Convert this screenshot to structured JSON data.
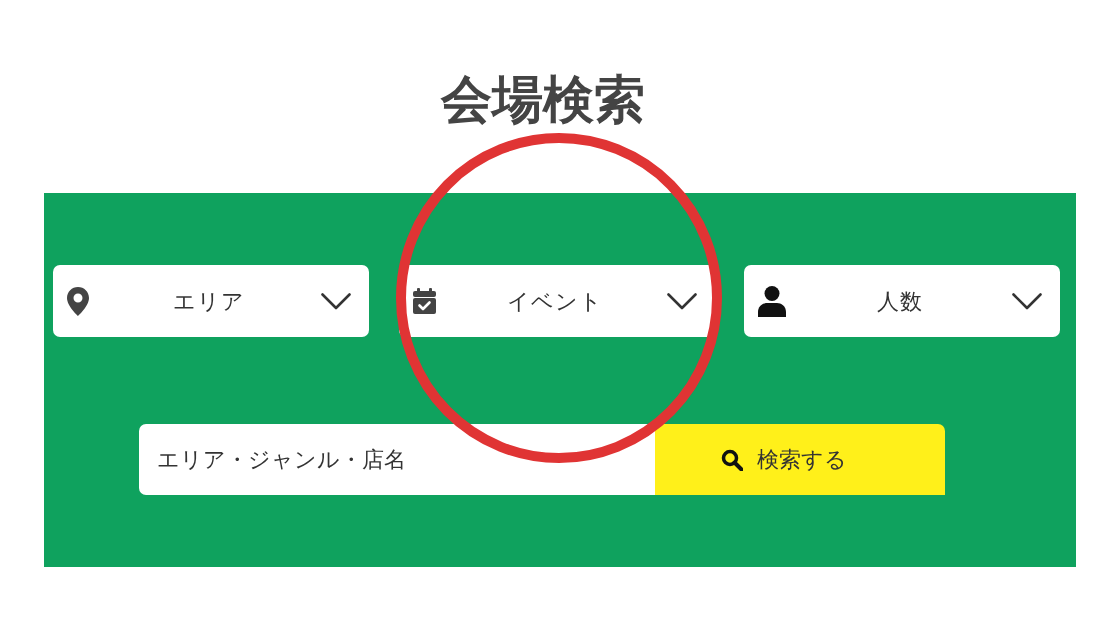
{
  "title": "会場検索",
  "filters": [
    {
      "label": "エリア",
      "highlighted": false
    },
    {
      "label": "イベント",
      "highlighted": true
    },
    {
      "label": "人数",
      "highlighted": false
    }
  ],
  "search": {
    "placeholder": "エリア・ジャンル・店名",
    "button": "検索する"
  }
}
